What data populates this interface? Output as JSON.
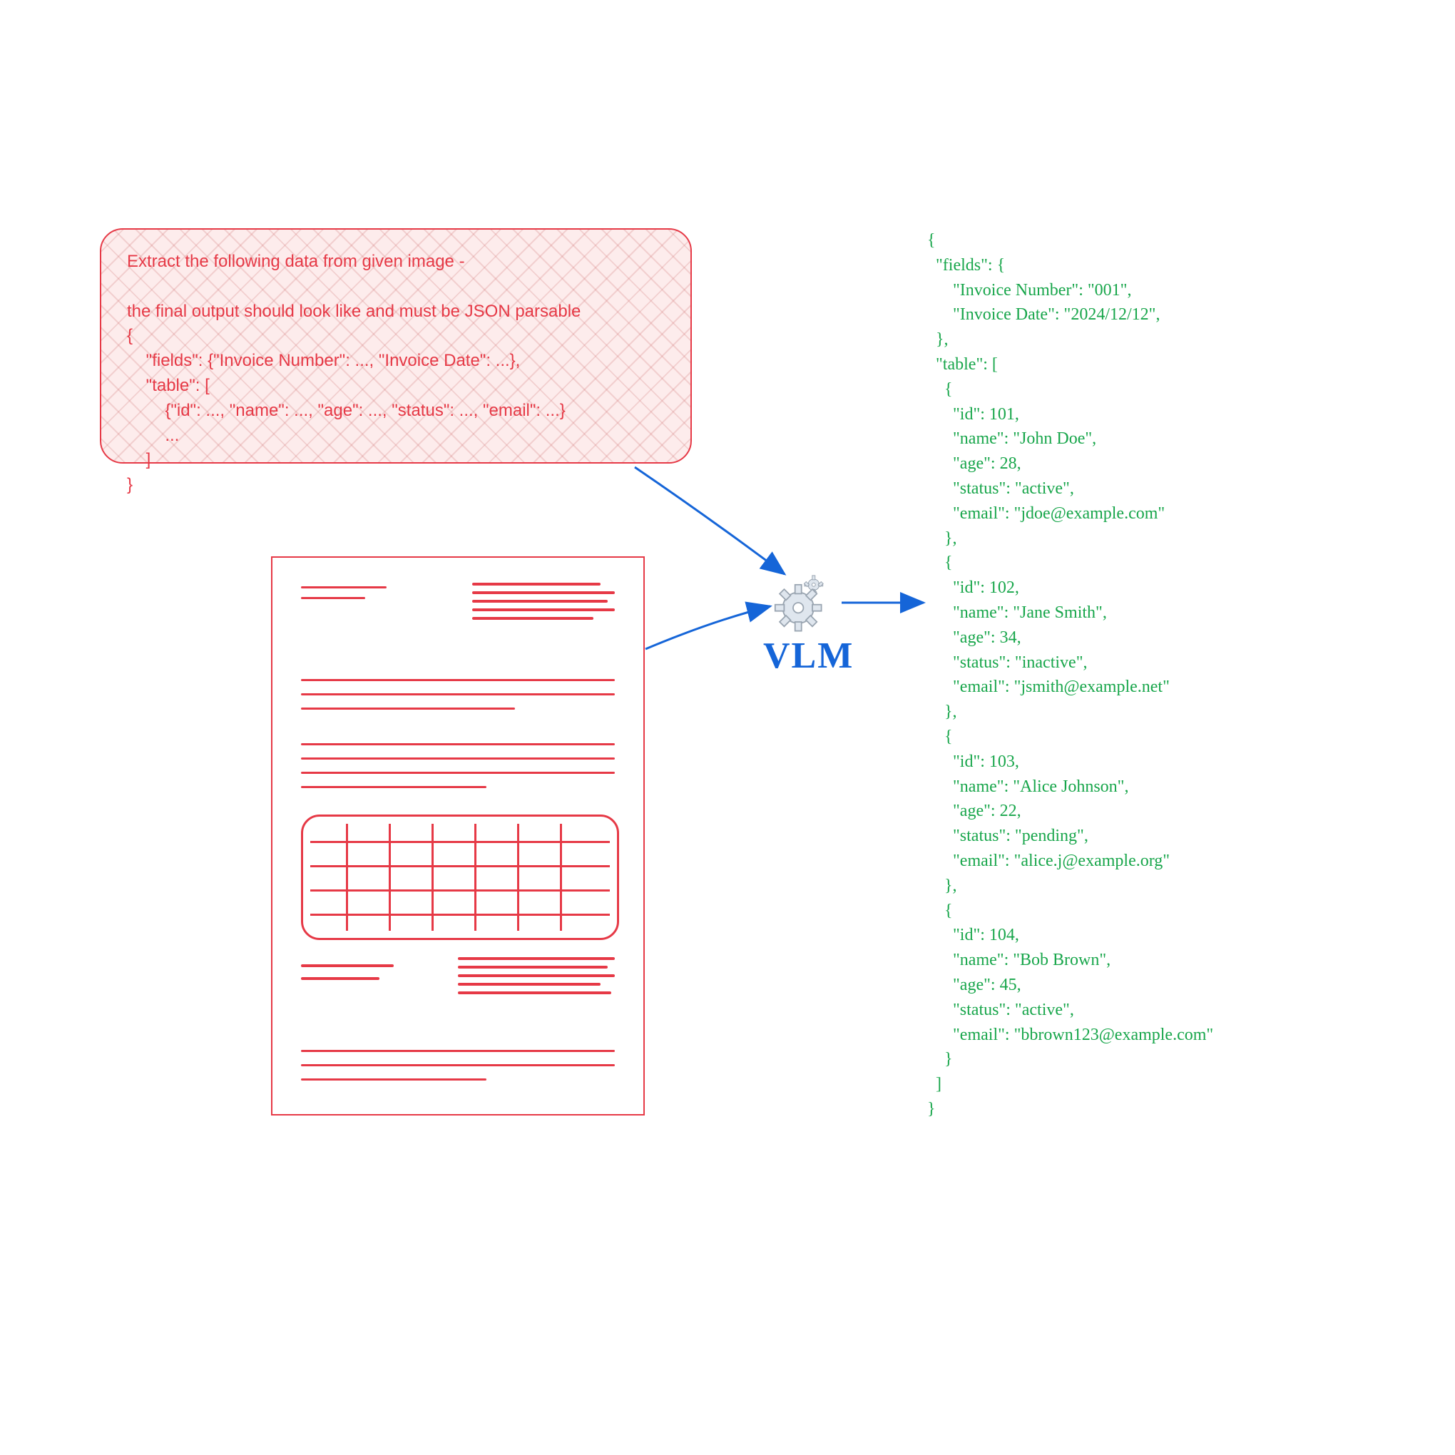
{
  "prompt": {
    "line1": "Extract the following data from given image -",
    "line2": "the final output should look like and must be JSON parsable",
    "line3": "{",
    "line4": "    \"fields\": {\"Invoice Number\": ..., \"Invoice Date\": ...},",
    "line5": "    \"table\": [",
    "line6": "        {\"id\": ..., \"name\": ..., \"age\": ..., \"status\": ..., \"email\": ...}",
    "line7": "        ...",
    "line8": "    ]",
    "line9": "}"
  },
  "vlm_label": "VLM",
  "output": {
    "l0": "{",
    "l1": "  \"fields\": {",
    "l2": "      \"Invoice Number\": \"001\",",
    "l3": "      \"Invoice Date\": \"2024/12/12\",",
    "l4": "  },",
    "l5": "  \"table\": [",
    "l6": "    {",
    "l7": "      \"id\": 101,",
    "l8": "      \"name\": \"John Doe\",",
    "l9": "      \"age\": 28,",
    "l10": "      \"status\": \"active\",",
    "l11": "      \"email\": \"jdoe@example.com\"",
    "l12": "    },",
    "l13": "    {",
    "l14": "      \"id\": 102,",
    "l15": "      \"name\": \"Jane Smith\",",
    "l16": "      \"age\": 34,",
    "l17": "      \"status\": \"inactive\",",
    "l18": "      \"email\": \"jsmith@example.net\"",
    "l19": "    },",
    "l20": "    {",
    "l21": "      \"id\": 103,",
    "l22": "      \"name\": \"Alice Johnson\",",
    "l23": "      \"age\": 22,",
    "l24": "      \"status\": \"pending\",",
    "l25": "      \"email\": \"alice.j@example.org\"",
    "l26": "    },",
    "l27": "    {",
    "l28": "      \"id\": 104,",
    "l29": "      \"name\": \"Bob Brown\",",
    "l30": "      \"age\": 45,",
    "l31": "      \"status\": \"active\",",
    "l32": "      \"email\": \"bbrown123@example.com\"",
    "l33": "    }",
    "l34": "  ]",
    "l35": "}"
  },
  "extracted_data": {
    "fields": {
      "Invoice Number": "001",
      "Invoice Date": "2024/12/12"
    },
    "table": [
      {
        "id": 101,
        "name": "John Doe",
        "age": 28,
        "status": "active",
        "email": "jdoe@example.com"
      },
      {
        "id": 102,
        "name": "Jane Smith",
        "age": 34,
        "status": "inactive",
        "email": "jsmith@example.net"
      },
      {
        "id": 103,
        "name": "Alice Johnson",
        "age": 22,
        "status": "pending",
        "email": "alice.j@example.org"
      },
      {
        "id": 104,
        "name": "Bob Brown",
        "age": 45,
        "status": "active",
        "email": "bbrown123@example.com"
      }
    ]
  },
  "colors": {
    "prompt_red": "#e63946",
    "output_green": "#18a64b",
    "arrow_blue": "#1565d8",
    "gear_fill": "#dfe6ee",
    "gear_stroke": "#9aa5b1"
  }
}
